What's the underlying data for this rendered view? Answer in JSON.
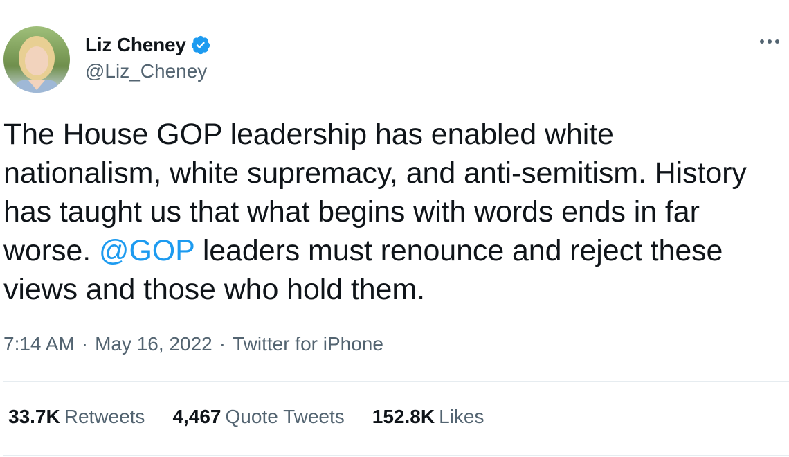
{
  "author": {
    "display_name": "Liz Cheney",
    "handle": "@Liz_Cheney",
    "verified": true,
    "avatar_icon": "profile-photo"
  },
  "more_icon": "more-horizontal-icon",
  "tweet": {
    "text_1": "The House GOP leadership has enabled white nationalism, white supremacy, and anti-semitism. History has taught us that what begins with words ends in far worse. ",
    "mention": "@GOP",
    "text_2": " leaders must renounce and reject these views and those who hold them."
  },
  "meta": {
    "time": "7:14 AM",
    "separator": "·",
    "date": "May 16, 2022",
    "source": "Twitter for iPhone"
  },
  "stats": {
    "retweets_count": "33.7K",
    "retweets_label": "Retweets",
    "quotes_count": "4,467",
    "quotes_label": "Quote Tweets",
    "likes_count": "152.8K",
    "likes_label": "Likes"
  },
  "colors": {
    "accent": "#1d9bf0",
    "text": "#0f1419",
    "secondary": "#536471"
  }
}
